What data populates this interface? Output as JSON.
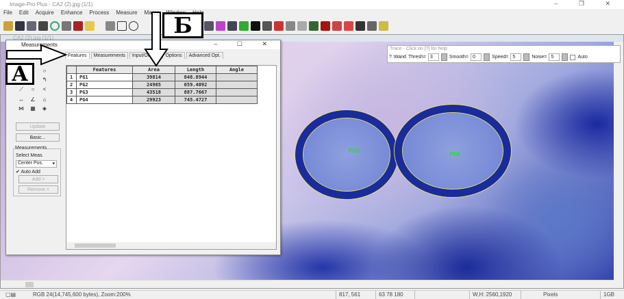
{
  "app": {
    "title": "Image-Pro Plus - CA2 (2).jpg (1/1)",
    "controls": "– ❐ ✕"
  },
  "menu": [
    "File",
    "Edit",
    "Acquire",
    "Enhance",
    "Process",
    "Measure",
    "Macro",
    "Window",
    "Help"
  ],
  "image_window": {
    "title": "CA2 (2).jpg (1/1)",
    "labels": [
      "PG1",
      "PG2"
    ]
  },
  "measurements": {
    "title": "Measurements",
    "controls": "– ☐ ✕",
    "tabs": [
      "Features",
      "Measurements",
      "Input/Output",
      "Options",
      "Advanced Opt."
    ],
    "columns": [
      "",
      "Features",
      "Area",
      "Length",
      "Angle"
    ],
    "rows": [
      [
        "1",
        "PG1",
        "39814",
        "848.8944",
        ""
      ],
      [
        "2",
        "PG2",
        "24965",
        "659.4092",
        ""
      ],
      [
        "3",
        "PG3",
        "43518",
        "887.7667",
        ""
      ],
      [
        "4",
        "PG4",
        "29923",
        "745.4727",
        ""
      ]
    ],
    "update": "Update",
    "basic": "Basic...",
    "group": "Measurements",
    "select_label": "Select Meas.",
    "select_value": "Center Pos.",
    "auto_add": "Auto Add",
    "add": "Add >",
    "remove": "Remove <"
  },
  "trace": {
    "title": "Trace - Click on [?] for help",
    "help": "?",
    "wand": "Wand",
    "thresh_label": "Thresh=",
    "thresh": "3",
    "smooth_label": "Smooth=",
    "smooth": "0",
    "speed_label": "Speed=",
    "speed": "5",
    "noise_label": "Noise=",
    "noise": "5",
    "auto": "Auto"
  },
  "status": {
    "info": "RGB 24(14,745,600 bytes), Zoom:200%",
    "coords": "817, 561",
    "rgb": "63 78 180",
    "wh": "W,H: 2560,1920",
    "units": "Pixels",
    "bank": "1GB"
  },
  "annotations": {
    "a": "А",
    "b": "Б"
  }
}
